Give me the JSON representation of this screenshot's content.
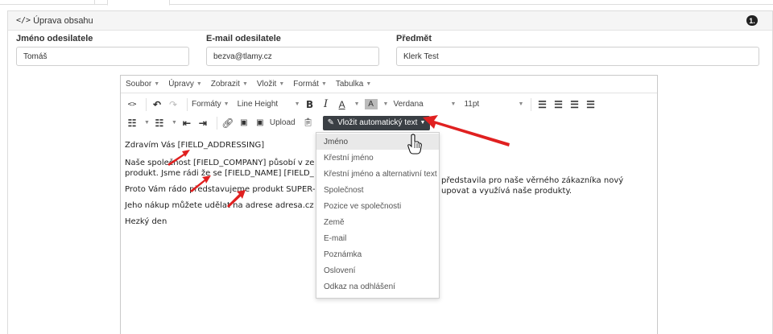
{
  "panel": {
    "title_icon": "</>",
    "title": "Úprava obsahu",
    "badge": "1."
  },
  "fields": {
    "sender_name_label": "Jméno odesilatele",
    "sender_name_value": "Tomáš",
    "sender_email_label": "E-mail odesilatele",
    "sender_email_value": "bezva@tlamy.cz",
    "subject_label": "Předmět",
    "subject_value": "Klerk Test"
  },
  "editor": {
    "menu": [
      "Soubor",
      "Úpravy",
      "Zobrazit",
      "Vložit",
      "Formát",
      "Tabulka"
    ],
    "toolbar": {
      "formats": "Formáty",
      "line_height": "Line Height",
      "bold": "B",
      "italic": "I",
      "text_color": "A",
      "bg_color": "A",
      "font": "Verdana",
      "size": "11pt",
      "upload": "Upload",
      "auto_text": "Vložit automatický text"
    },
    "content": [
      "Zdravím Vás [FIELD_ADDRESSING]",
      "",
      "Naše společnost [FIELD_COMPANY] působí v ze",
      "produkt. Jsme rádi že se [FIELD_NAME] [FIELD_",
      "",
      "Proto Vám rádo představujeme produkt SUPER-F",
      "",
      "Jeho nákup můžete udělat na adrese adresa.cz",
      "",
      "Hezký den"
    ],
    "content_right": [
      "představila pro naše věrného zákazníka nový",
      "upovat a využívá naše produkty."
    ]
  },
  "dropdown": {
    "items": [
      "Jméno",
      "Křestní jméno",
      "Křestní jméno a alternativní text",
      "Společnost",
      "Pozice ve společnosti",
      "Země",
      "E-mail",
      "Poznámka",
      "Oslovení",
      "Odkaz na odhlášení"
    ]
  },
  "colors": {
    "arrow": "#e02020",
    "button_dark": "#3a3f44"
  }
}
